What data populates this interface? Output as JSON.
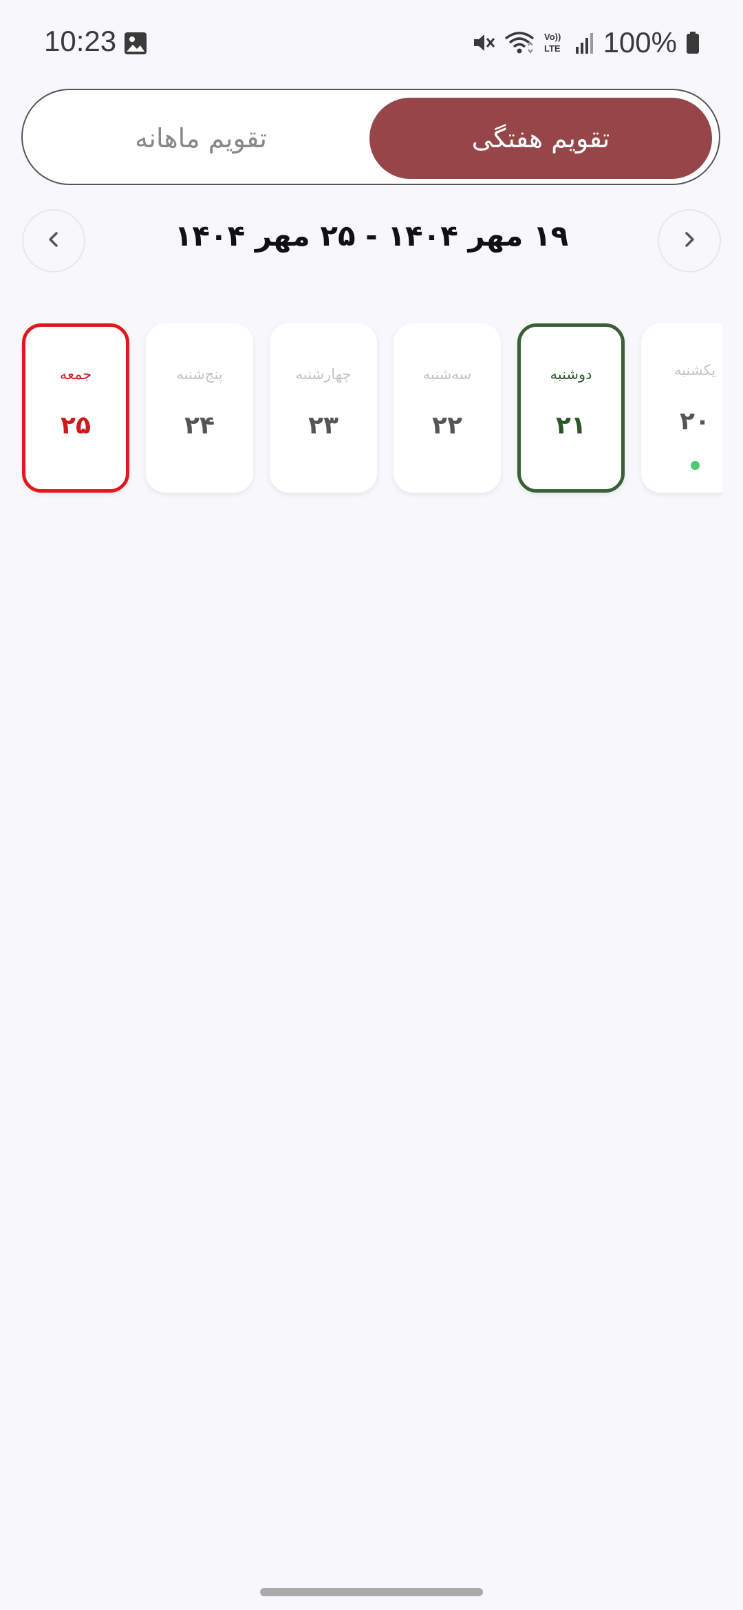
{
  "status_bar": {
    "time": "10:23",
    "battery": "100%",
    "icons": [
      "gallery-icon",
      "mute-icon",
      "wifi-icon",
      "volte-icon",
      "signal-icon",
      "battery-icon"
    ]
  },
  "tabs": {
    "weekly": "تقویم هفتگی",
    "monthly": "تقویم ماهانه",
    "active": "weekly"
  },
  "week_nav": {
    "range": "۱۹ مهر ۱۴۰۴ - ۲۵ مهر ۱۴۰۴",
    "prev_icon": "chevron-left-icon",
    "next_icon": "chevron-right-icon"
  },
  "days": [
    {
      "name": "جمعه",
      "number": "۲۵",
      "state": "selected"
    },
    {
      "name": "پنج‌شنبه",
      "number": "۲۴",
      "state": "normal"
    },
    {
      "name": "چهارشنبه",
      "number": "۲۳",
      "state": "normal"
    },
    {
      "name": "سه‌شنبه",
      "number": "۲۲",
      "state": "normal"
    },
    {
      "name": "دوشنبه",
      "number": "۲۱",
      "state": "today"
    },
    {
      "name": "یکشنبه",
      "number": "۲۰",
      "state": "has-event"
    }
  ],
  "colors": {
    "accent": "#964549",
    "selected_border": "#e0181c",
    "today_border": "#3a6135",
    "event_dot": "#4cc973",
    "background": "#f8f8fc"
  }
}
